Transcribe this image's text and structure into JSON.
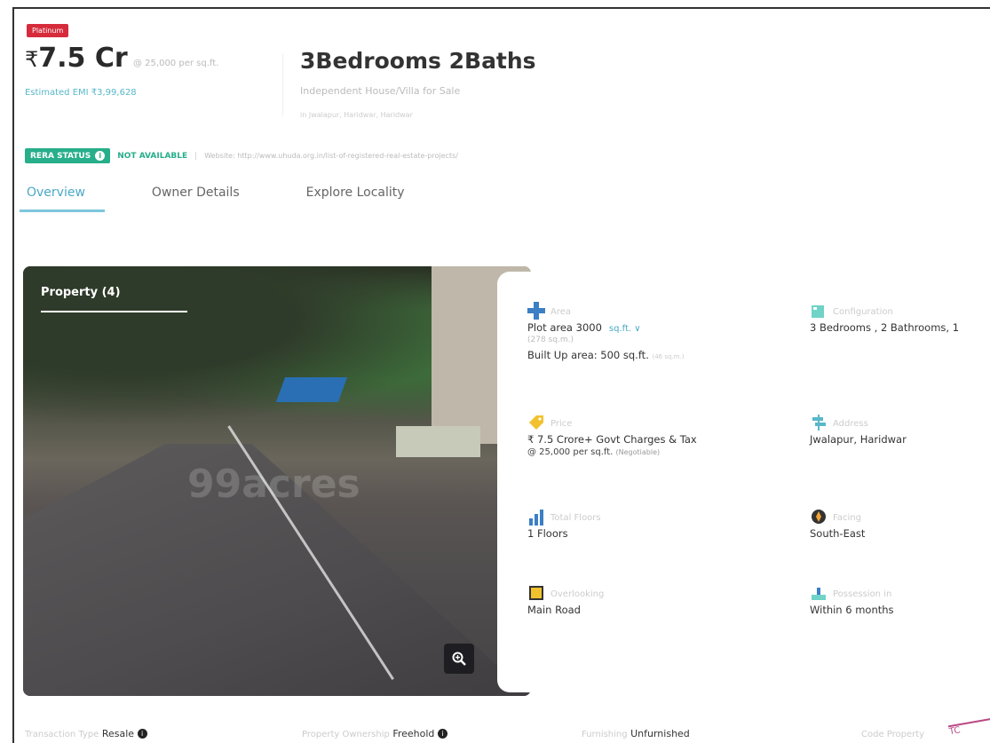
{
  "header": {
    "badge": "Platinum",
    "price_symbol": "₹",
    "price": "7.5 Cr",
    "per_sqft": "@ 25,000 per sq.ft.",
    "emi": "Estimated EMI ₹3,99,628",
    "title": "3Bedrooms 2Baths",
    "subtitle": "Independent House/Villa for Sale",
    "location": "in Jwalapur, Haridwar, Haridwar"
  },
  "rera": {
    "label": "RERA STATUS",
    "status": "NOT AVAILABLE",
    "separator": "|",
    "website": "Website: http://www.uhuda.org.in/list-of-registered-real-estate-projects/"
  },
  "tabs": [
    {
      "label": "Overview"
    },
    {
      "label": "Owner Details"
    },
    {
      "label": "Explore Locality"
    }
  ],
  "gallery": {
    "label": "Property (4)",
    "watermark": "99acres",
    "zoom_icon": "magnifier-icon"
  },
  "details": {
    "area": {
      "label": "Area",
      "value": "Plot area 3000",
      "unit": "sq.ft. ∨",
      "extra_label": "(278 sq.m.)",
      "built_up": "Built Up area: 500 sq.ft.",
      "built_up_note": "(46 sq.m.)"
    },
    "configuration": {
      "label": "Configuration",
      "value": "3 Bedrooms , 2 Bathrooms, 1"
    },
    "price": {
      "label": "Price",
      "value": "₹ 7.5 Crore+ Govt Charges & Tax",
      "sub": "@ 25,000 per sq.ft.",
      "sub_note": "(Negotiable)"
    },
    "address": {
      "label": "Address",
      "value": "Jwalapur, Haridwar"
    },
    "floors": {
      "label": "Total Floors",
      "value": "1 Floors"
    },
    "facing": {
      "label": "Facing",
      "value": "South-East"
    },
    "overlooking": {
      "label": "Overlooking",
      "value": "Main Road"
    },
    "possession": {
      "label": "Possession in",
      "value": "Within 6 months"
    }
  },
  "bottom": {
    "transaction_label": "Transaction Type",
    "transaction_value": "Resale",
    "ownership_label": "Property Ownership",
    "ownership_value": "Freehold",
    "furnishing_label": "Furnishing",
    "furnishing_value": "Unfurnished",
    "code_label": "Code Property",
    "info_glyph": "i",
    "stamp_text": "TC"
  }
}
